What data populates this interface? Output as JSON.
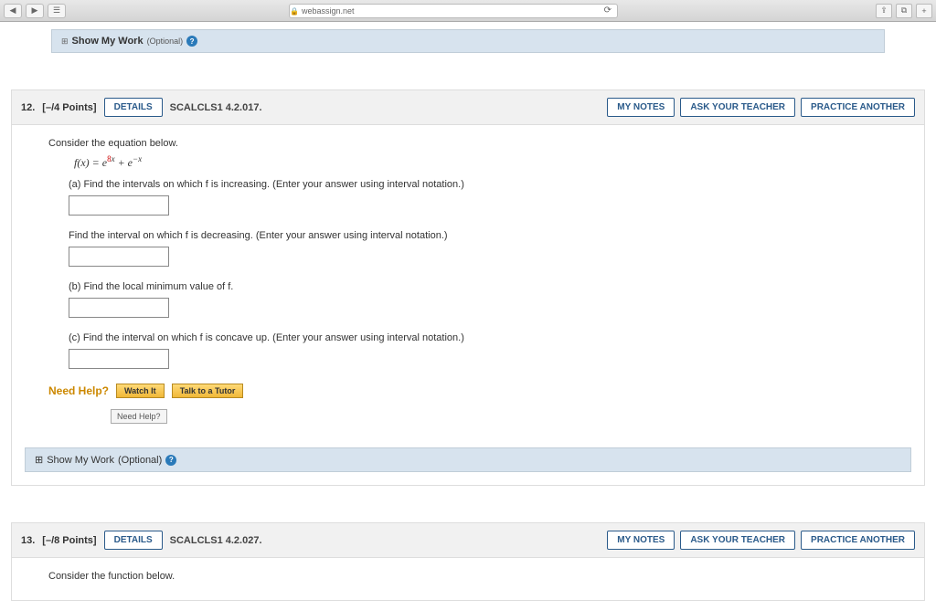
{
  "browser": {
    "url": "webassign.net"
  },
  "showWork": {
    "label": "Show My Work",
    "optional": "(Optional)"
  },
  "q12": {
    "number": "12.",
    "points": "[–/4 Points]",
    "details": "DETAILS",
    "ref": "SCALCLS1 4.2.017.",
    "myNotes": "MY NOTES",
    "askTeacher": "ASK YOUR TEACHER",
    "practice": "PRACTICE ANOTHER",
    "intro": "Consider the equation below.",
    "partA": "(a) Find the intervals on which f is increasing. (Enter your answer using interval notation.)",
    "partA2": "Find the interval on which f is decreasing. (Enter your answer using interval notation.)",
    "partB": "(b) Find the local minimum value of f.",
    "partC": "(c) Find the interval on which f is concave up. (Enter your answer using interval notation.)",
    "needHelp": "Need Help?",
    "watchIt": "Watch It",
    "talkTutor": "Talk to a Tutor",
    "tooltip": "Need Help?"
  },
  "q13": {
    "number": "13.",
    "points": "[–/8 Points]",
    "details": "DETAILS",
    "ref": "SCALCLS1 4.2.027.",
    "myNotes": "MY NOTES",
    "askTeacher": "ASK YOUR TEACHER",
    "practice": "PRACTICE ANOTHER",
    "intro": "Consider the function below."
  }
}
